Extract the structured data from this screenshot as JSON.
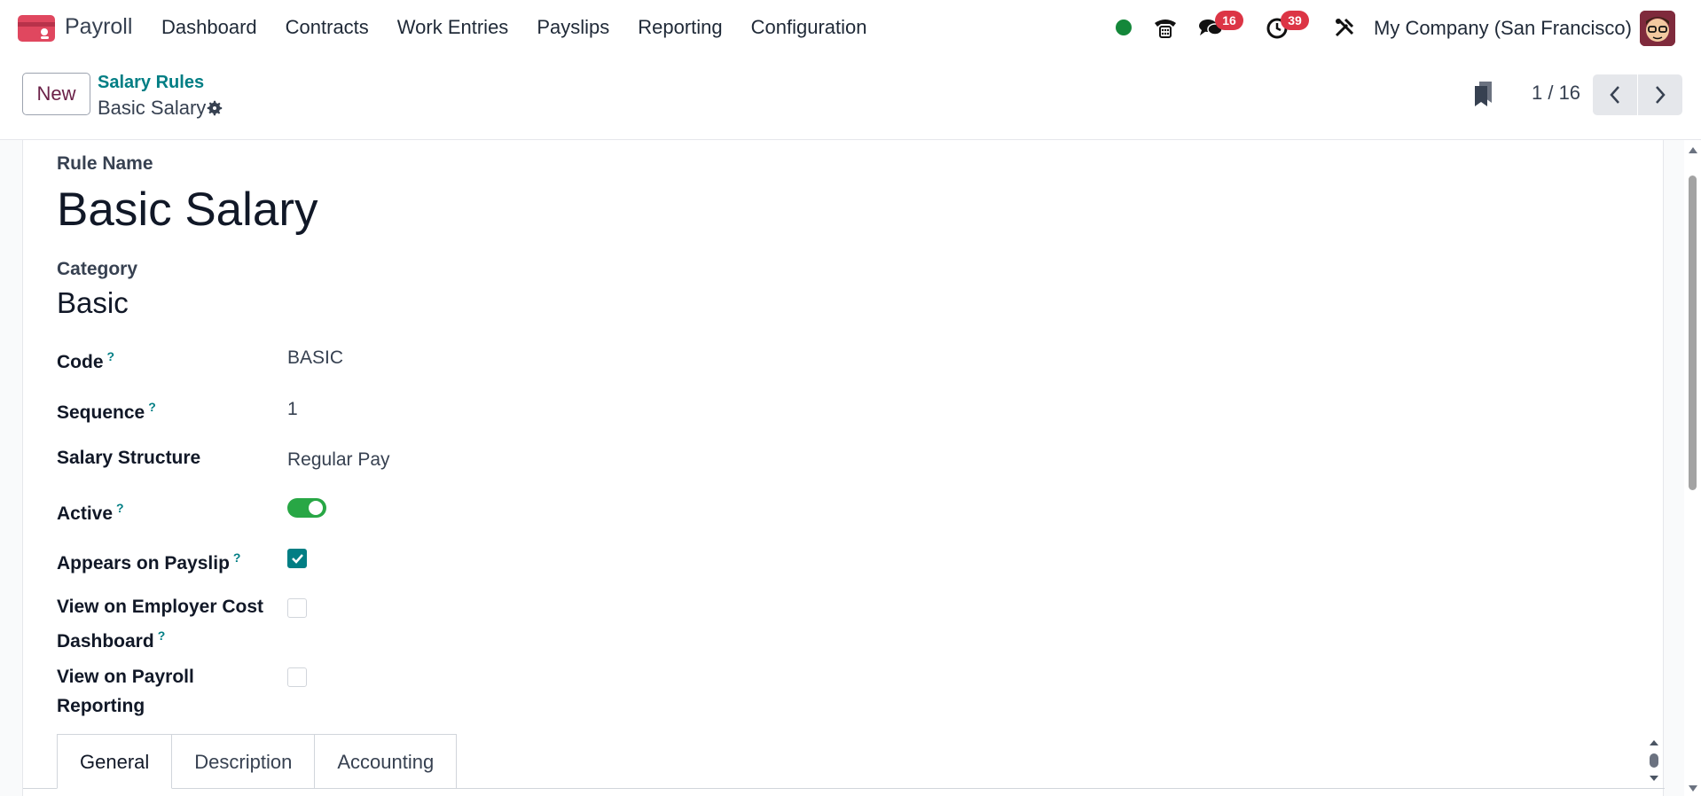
{
  "app": {
    "name": "Payroll"
  },
  "menu": [
    "Dashboard",
    "Contracts",
    "Work Entries",
    "Payslips",
    "Reporting",
    "Configuration"
  ],
  "systray": {
    "messages_count": "16",
    "activities_count": "39",
    "company": "My Company (San Francisco)",
    "presence_color": "#14873a"
  },
  "control_panel": {
    "new_label": "New",
    "breadcrumb_parent": "Salary Rules",
    "breadcrumb_current": "Basic Salary",
    "pager": "1 / 16"
  },
  "form": {
    "rule_name_label": "Rule Name",
    "rule_name": "Basic Salary",
    "category_label": "Category",
    "category": "Basic",
    "help_mark": "?",
    "fields": {
      "code_label": "Code",
      "code": "BASIC",
      "sequence_label": "Sequence",
      "sequence": "1",
      "structure_label": "Salary Structure",
      "structure": "Regular Pay",
      "active_label": "Active",
      "active": true,
      "appears_label": "Appears on Payslip",
      "appears": true,
      "employer_cost_label_line1": "View on Employer Cost",
      "employer_cost_label_line2": "Dashboard",
      "employer_cost": false,
      "payroll_reporting_label_line1": "View on Payroll",
      "payroll_reporting_label_line2": "Reporting",
      "payroll_reporting": false
    }
  },
  "tabs": [
    "General",
    "Description",
    "Accounting"
  ],
  "colors": {
    "accent": "#017e84",
    "brand": "#6b2148",
    "badge": "#dc3545",
    "toggle_on": "#28a745"
  },
  "icons": {
    "app": "payroll-app-icon",
    "phone": "phone-icon",
    "chat": "chat-icon",
    "activity": "clock-icon",
    "tools": "tools-icon",
    "gear": "gear-icon",
    "bookmark": "bookmark-icon",
    "prev": "chevron-left-icon",
    "next": "chevron-right-icon"
  }
}
